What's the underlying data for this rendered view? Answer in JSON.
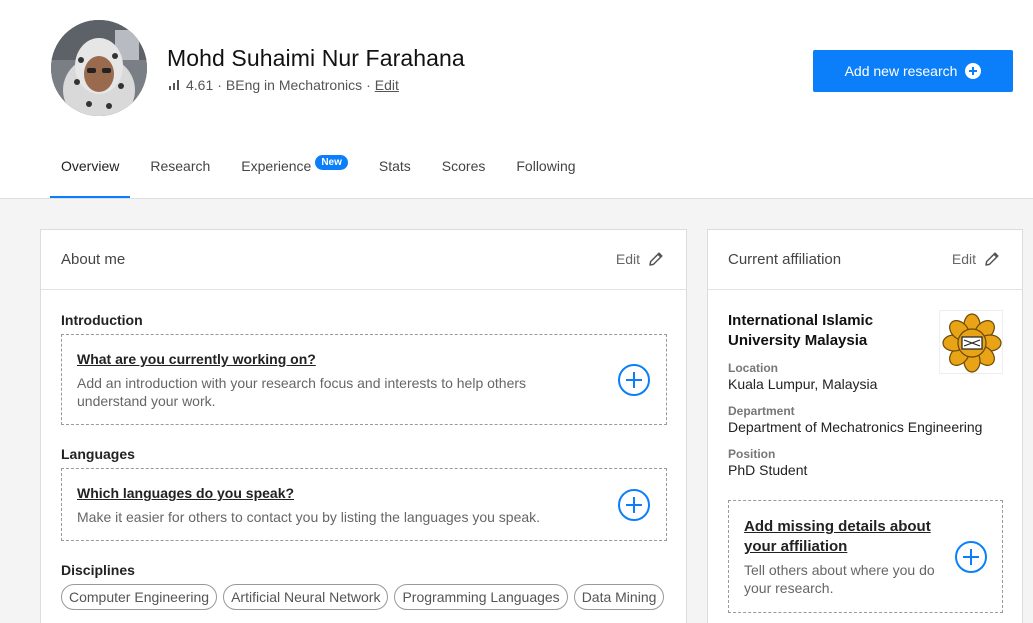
{
  "profile": {
    "name": "Mohd Suhaimi Nur Farahana",
    "score": "4.61",
    "separator1": "·",
    "degree": "BEng in Mechatronics",
    "separator2": "·",
    "edit_label": "Edit"
  },
  "actions": {
    "add_research_label": "Add new research"
  },
  "tabs": [
    {
      "label": "Overview"
    },
    {
      "label": "Research"
    },
    {
      "label": "Experience",
      "badge": "New"
    },
    {
      "label": "Stats"
    },
    {
      "label": "Scores"
    },
    {
      "label": "Following"
    }
  ],
  "about": {
    "title": "About me",
    "edit_label": "Edit",
    "introduction": {
      "label": "Introduction",
      "question": "What are you currently working on?",
      "description": "Add an introduction with your research focus and interests to help others understand your work."
    },
    "languages": {
      "label": "Languages",
      "question": "Which languages do you speak?",
      "description": "Make it easier for others to contact you by listing the languages you speak."
    },
    "disciplines": {
      "label": "Disciplines",
      "items": [
        "Computer Engineering",
        "Artificial Neural Network",
        "Programming Languages",
        "Data Mining"
      ]
    }
  },
  "affiliation": {
    "title": "Current affiliation",
    "edit_label": "Edit",
    "institution": "International Islamic University Malaysia",
    "location_label": "Location",
    "location": "Kuala Lumpur, Malaysia",
    "department_label": "Department",
    "department": "Department of Mechatronics Engineering",
    "position_label": "Position",
    "position": "PhD Student",
    "missing_title": "Add missing details about your affiliation",
    "missing_description": "Tell others about where you do your research."
  },
  "colors": {
    "accent": "#0b7ffa",
    "logo_gold": "#e8a317"
  }
}
